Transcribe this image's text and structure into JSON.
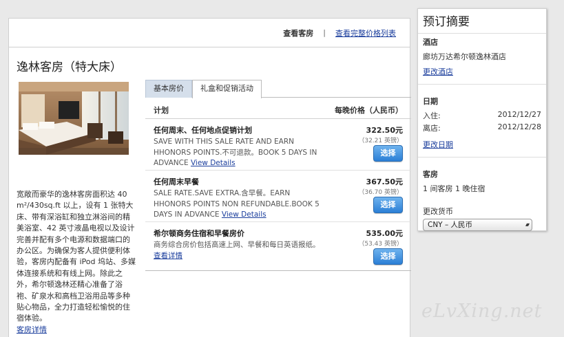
{
  "topbar": {
    "current": "查看客房",
    "separator": "|",
    "full_price_link": "查看完整价格列表"
  },
  "room": {
    "title": "逸林客房（特大床）",
    "description": "宽敞而豪华的逸林客房面积达 40 m²/430sq.ft 以上，设有 1 张特大床、带有深浴缸和独立淋浴间的精美浴室、42 英寸液晶电视以及设计完善并配有多个电源和数据端口的办公区。为确保为客人提供便利体验，客房内配备有 iPod 坞站、多媒体连接系统和有线上网。除此之外，希尔顿逸林还精心准备了浴袍、矿泉水和高档卫浴用品等多种贴心物品，全力打造轻松愉悦的住宿体验。",
    "details_link": "客房详情"
  },
  "tabs": [
    {
      "label": "基本房价"
    },
    {
      "label": "礼盒和促销活动"
    }
  ],
  "rates_header": {
    "plan": "计划",
    "price": "每晚价格（人民币）"
  },
  "rates": [
    {
      "name": "任何周末、任何地点促销计划",
      "text": "SAVE WITH THIS SALE RATE AND EARN HHONORS POINTS.不可退款。BOOK 5 DAYS IN ADVANCE",
      "link": "View Details",
      "price": "322.50元",
      "alt_price": "（32.21 英镑）",
      "button": "选择"
    },
    {
      "name": "任何周末早餐",
      "text": "SALE RATE.SAVE EXTRA.含早餐。EARN HHONORS POINTS NON REFUNDABLE.BOOK 5 DAYS IN ADVANCE",
      "link": "View Details",
      "price": "367.50元",
      "alt_price": "（36.70 英镑）",
      "button": "选择"
    },
    {
      "name": "希尔顿商务住宿和早餐房价",
      "text": "商务综合房价包括高速上网、早餐和每日英语报纸。",
      "link": "查看详情",
      "price": "535.00元",
      "alt_price": "（53.43 英镑）",
      "button": "选择"
    }
  ],
  "summary": {
    "title": "预订摘要",
    "hotel_label": "酒店",
    "hotel_name": "廊坊万达希尔顿逸林酒店",
    "change_hotel": "更改酒店",
    "date_label": "日期",
    "checkin_label": "入住:",
    "checkin": "2012/12/27",
    "checkout_label": "离店:",
    "checkout": "2012/12/28",
    "change_date": "更改日期",
    "rooms_label": "客房",
    "rooms_value": "1 间客房 1 晚住宿",
    "currency_label": "更改货币",
    "currency_value": "CNY – 人民币"
  },
  "watermark": "eLvXing.net"
}
